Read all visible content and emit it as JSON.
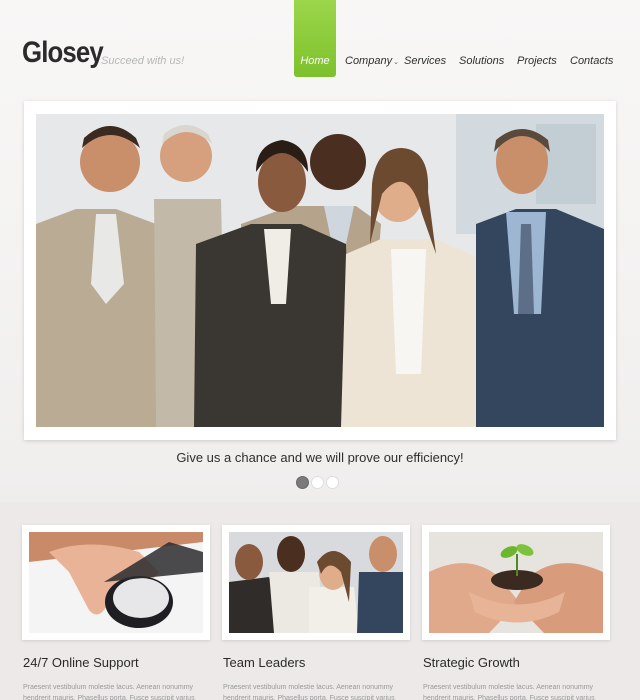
{
  "header": {
    "logo": "Glosey",
    "slogan": "Succeed with us!"
  },
  "nav": {
    "items": [
      {
        "label": "Home",
        "active": true
      },
      {
        "label": "Company",
        "has_dropdown": true
      },
      {
        "label": "Services"
      },
      {
        "label": "Solutions"
      },
      {
        "label": "Projects"
      },
      {
        "label": "Contacts"
      }
    ],
    "accent_color": "#8ccc3c"
  },
  "slider": {
    "caption": "Give us a chance and we will prove our efficiency!",
    "slide_count": 3,
    "active_slide": 1
  },
  "features": [
    {
      "title": "24/7 Online Support",
      "text": "Praesent vestibulum molestie lacus. Aenean nonummy hendrerit mauris. Phasellus porta. Fusce suscipit varius"
    },
    {
      "title": "Team Leaders",
      "text": "Praesent vestibulum molestie lacus. Aenean nonummy hendrerit mauris. Phasellus porta. Fusce suscipit varius"
    },
    {
      "title": "Strategic Growth",
      "text": "Praesent vestibulum molestie lacus. Aenean nonummy hendrerit mauris. Phasellus porta. Fusce suscipit varius"
    }
  ]
}
